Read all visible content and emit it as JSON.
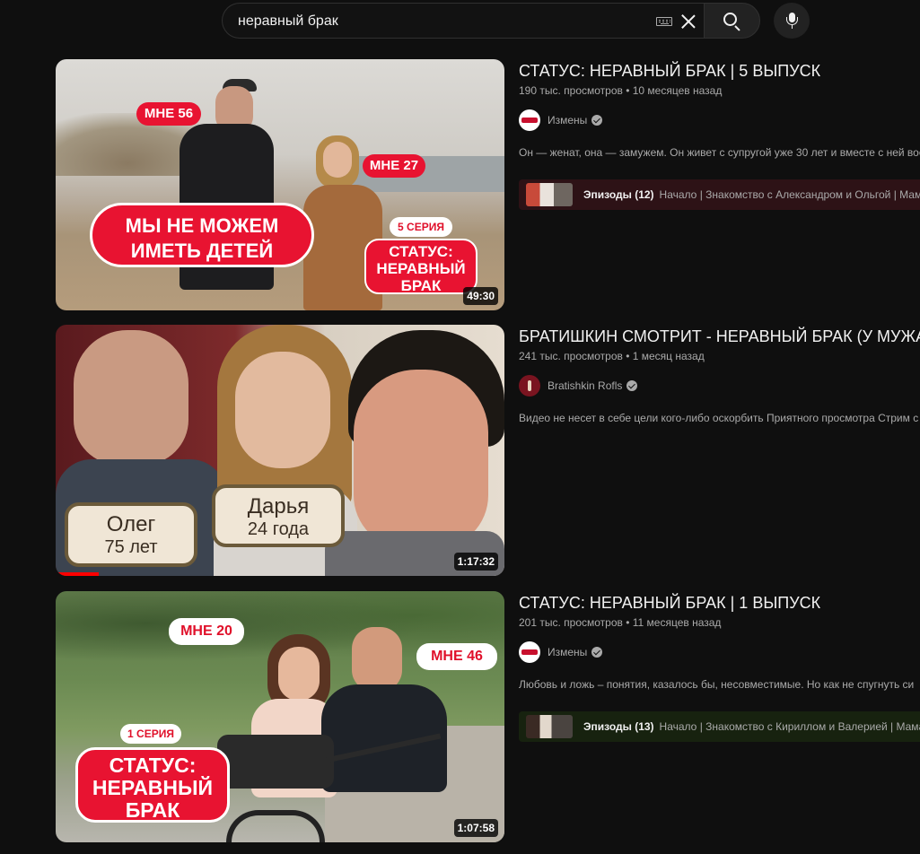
{
  "search": {
    "query": "неравный брак"
  },
  "results": [
    {
      "title": "СТАТУС: НЕРАВНЫЙ БРАК | 5 ВЫПУСК",
      "views": "190 тыс. просмотров",
      "age": "10 месяцев назад",
      "channel": "Измены",
      "description": "Он — женат, она — замужем. Он живет с супругой уже 30 лет и вместе с ней вос",
      "duration": "49:30",
      "episodes_label": "Эпизоды (12)",
      "episodes_list": "Начало | Знакомство с Александром и Ольгой | Мам",
      "thumb_text": {
        "age_left": "МНЕ 56",
        "age_right": "МНЕ 27",
        "headline_1": "МЫ НЕ МОЖЕМ",
        "headline_2": "ИМЕТЬ ДЕТЕЙ",
        "series": "5 СЕРИЯ",
        "show_1": "СТАТУС:",
        "show_2": "НЕРАВНЫЙ",
        "show_3": "БРАК"
      },
      "colors": {
        "episodes_bg": "#2d1216"
      }
    },
    {
      "title": "БРАТИШКИН СМОТРИТ - НЕРАВНЫЙ БРАК (У МУЖА С",
      "views": "241 тыс. просмотров",
      "age": "1 месяц назад",
      "channel": "Bratishkin Rofls",
      "description": "Видео не несет в себе цели кого-либо оскорбить Приятного просмотра Стрим с",
      "duration": "1:17:32",
      "thumb_text": {
        "name_1": "Олег",
        "age_1": "75 лет",
        "name_2": "Дарья",
        "age_2": "24 года"
      }
    },
    {
      "title": "СТАТУС: НЕРАВНЫЙ БРАК | 1 ВЫПУСК",
      "views": "201 тыс. просмотров",
      "age": "11 месяцев назад",
      "channel": "Измены",
      "description": "Любовь и ложь – понятия, казалось бы, несовместимые. Но как не спугнуть си",
      "duration": "1:07:58",
      "episodes_label": "Эпизоды (13)",
      "episodes_list": "Начало | Знакомство с Кириллом и Валерией | Мама",
      "thumb_text": {
        "age_left": "МНЕ 20",
        "age_right": "МНЕ 46",
        "series": "1 СЕРИЯ",
        "show_1": "СТАТУС:",
        "show_2": "НЕРАВНЫЙ",
        "show_3": "БРАК"
      },
      "colors": {
        "episodes_bg": "#17220f"
      }
    }
  ],
  "icons": [
    "keyboard-icon",
    "clear-icon",
    "search-icon",
    "mic-icon",
    "verified-icon"
  ]
}
